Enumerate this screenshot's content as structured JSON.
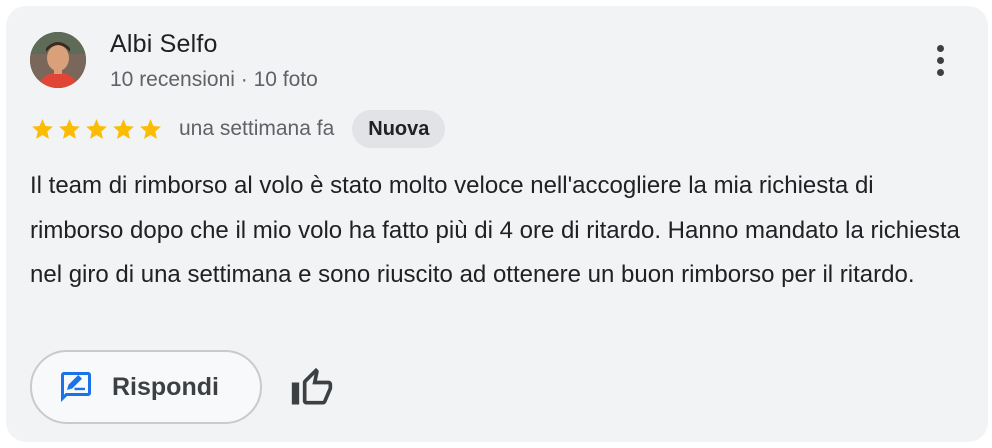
{
  "review": {
    "author": {
      "name": "Albi Selfo",
      "meta": "10 recensioni · 10 foto"
    },
    "rating": 5,
    "time_ago": "una settimana fa",
    "badge": "Nuova",
    "text": "Il team di rimborso al volo è stato molto veloce nell'accogliere la mia richiesta di rimborso dopo che il mio volo ha fatto più di 4 ore di ritardo. Hanno mandato la richiesta nel giro di una settimana e sono riuscito ad ottenere un buon rimborso per il ritardo.",
    "actions": {
      "reply_label": "Rispondi"
    }
  },
  "icons": {
    "menu": "more-vert-icon",
    "star": "star-icon",
    "reply": "rate-review-icon",
    "like": "thumb-up-icon"
  },
  "colors": {
    "card_background": "#f1f3f4",
    "star": "#fbbc04",
    "reply_icon": "#1a73e8",
    "badge_background": "#e1e3e6"
  }
}
